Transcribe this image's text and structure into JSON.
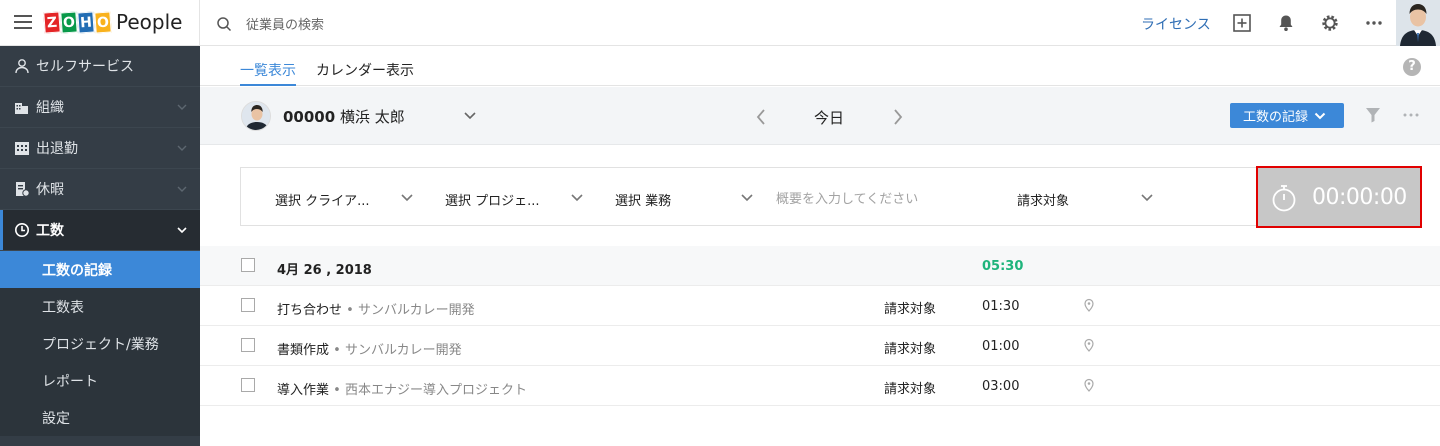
{
  "app": {
    "product_name": "People",
    "logo_letters": [
      "Z",
      "O",
      "H",
      "O"
    ]
  },
  "header": {
    "search_placeholder": "従業員の検索",
    "license_link": "ライセンス",
    "icons": [
      "add-square-icon",
      "bell-icon",
      "gear-icon",
      "more-icon"
    ]
  },
  "sidebar": {
    "items": [
      {
        "label": "セルフサービス",
        "icon": "person-icon"
      },
      {
        "label": "組織",
        "icon": "building-icon"
      },
      {
        "label": "出退勤",
        "icon": "calendar-grid-icon"
      },
      {
        "label": "休暇",
        "icon": "leave-icon"
      },
      {
        "label": "工数",
        "icon": "clock-icon"
      }
    ],
    "sub_items": [
      {
        "label": "工数の記録"
      },
      {
        "label": "工数表"
      },
      {
        "label": "プロジェクト/業務"
      },
      {
        "label": "レポート"
      },
      {
        "label": "設定"
      }
    ]
  },
  "tabs": [
    {
      "label": "一覧表示"
    },
    {
      "label": "カレンダー表示"
    }
  ],
  "toolbar": {
    "employee_id": "00000",
    "employee_name": "横浜 太郎",
    "date_label": "今日",
    "log_button": "工数の記録"
  },
  "entry_form": {
    "client": "選択 クライア...",
    "project": "選択 プロジェ...",
    "job": "選択 業務",
    "description_placeholder": "概要を入力してください",
    "billable": "請求対象",
    "timer": "00:00:00"
  },
  "log_list": {
    "date": "4月 26 , 2018",
    "total": "05:30",
    "entries": [
      {
        "task": "打ち合わせ",
        "project": "サンバルカレー開発",
        "billable": "請求対象",
        "hours": "01:30"
      },
      {
        "task": "書類作成",
        "project": "サンバルカレー開発",
        "billable": "請求対象",
        "hours": "01:00"
      },
      {
        "task": "導入作業",
        "project": "西本エナジー導入プロジェクト",
        "billable": "請求対象",
        "hours": "03:00"
      }
    ]
  },
  "colors": {
    "accent": "#3c88d8",
    "sidebar_bg": "#343d46",
    "total_green": "#1fb47c",
    "timer_bg": "#c7c7c7",
    "highlight": "#e10000"
  }
}
